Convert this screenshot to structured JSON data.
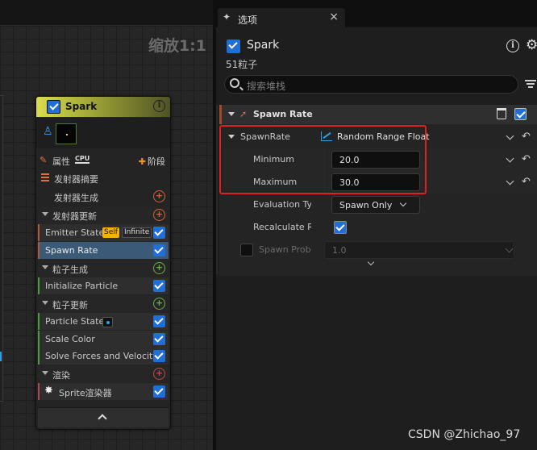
{
  "graph": {
    "zoom_label": "缩放1:1"
  },
  "node": {
    "title": "Spark",
    "props_label": "属性",
    "cpu_label": "CPU",
    "stage_label": "阶段",
    "header_color": "#d9dd4f",
    "rows": [
      {
        "label": "发射器摘要"
      },
      {
        "label": "发射器生成"
      },
      {
        "label": "发射器更新"
      },
      {
        "label": "Emitter State",
        "badges": [
          "Self",
          "Infinite"
        ]
      },
      {
        "label": "Spawn Rate"
      },
      {
        "label": "粒子生成"
      },
      {
        "label": "Initialize Particle"
      },
      {
        "label": "粒子更新"
      },
      {
        "label": "Particle State"
      },
      {
        "label": "Scale Color"
      },
      {
        "label": "Solve Forces and Velocity"
      },
      {
        "label": "渲染"
      },
      {
        "label": "Sprite渲染器"
      }
    ]
  },
  "panel": {
    "tab_label": "选项",
    "close_glyph": "×",
    "title": "Spark",
    "particle_count": "51粒子",
    "search_placeholder": "搜索堆栈",
    "section_title": "Spawn Rate",
    "properties": {
      "spawnrate_label": "SpawnRate",
      "spawnrate_function": "Random Range Float",
      "minimum_label": "Minimum",
      "minimum_value": "20.0",
      "maximum_label": "Maximum",
      "maximum_value": "30.0",
      "evaluation_label": "Evaluation Typ",
      "evaluation_value": "Spawn Only",
      "recalculate_label": "Recalculate Ra",
      "recalculate_checked": true,
      "spawn_prob_label": "Spawn Proba",
      "spawn_prob_value": "1.0"
    },
    "accent_color": "#1f6fd6",
    "highlight_color": "#e02020"
  },
  "watermark": "CSDN @Zhichao_97"
}
